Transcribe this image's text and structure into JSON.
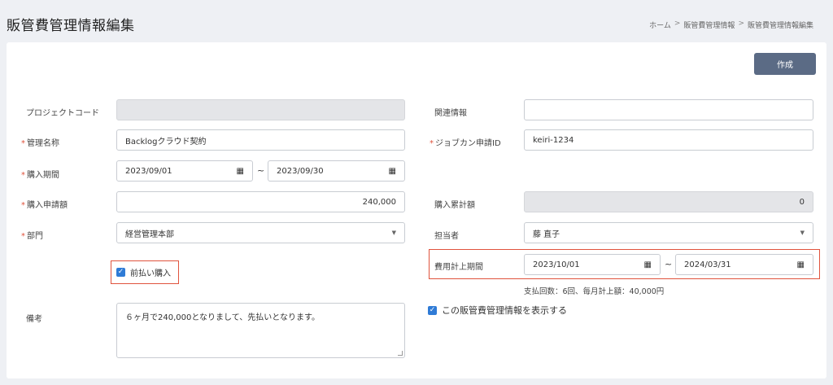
{
  "header": {
    "title": "販管費管理情報編集",
    "breadcrumb": [
      "ホーム",
      "販管費管理情報",
      "販管費管理情報編集"
    ],
    "breadcrumb_sep": ">"
  },
  "actions": {
    "create_label": "作成"
  },
  "form": {
    "project_code": {
      "label": "プロジェクトコード",
      "value": ""
    },
    "related_info": {
      "label": "関連情報",
      "value": ""
    },
    "management_name": {
      "label": "管理名称",
      "value": "Backlogクラウド契約"
    },
    "jobcan_id": {
      "label": "ジョブカン申請ID",
      "value": "keiri-1234"
    },
    "purchase_period": {
      "label": "購入期間",
      "start": "2023/09/01",
      "end": "2023/09/30"
    },
    "purchase_amount": {
      "label": "購入申請額",
      "value": "240,000"
    },
    "purchase_total": {
      "label": "購入累計額",
      "value": "0"
    },
    "department": {
      "label": "部門",
      "value": "経営管理本部"
    },
    "person": {
      "label": "担当者",
      "value": "藤 直子"
    },
    "prepaid": {
      "label": "前払い購入",
      "checked": true
    },
    "expense_period": {
      "label": "費用計上期間",
      "start": "2023/10/01",
      "end": "2024/03/31"
    },
    "payment_note": "支払回数：6回、毎月計上額：40,000円",
    "remarks": {
      "label": "備考",
      "value": "６ヶ月で240,000となりまして、先払いとなります。"
    },
    "show_toggle": {
      "label": "この販管費管理情報を表示する",
      "checked": true
    },
    "required_mark": "*",
    "tilde": "~"
  },
  "colors": {
    "accent": "#2f7bd6",
    "button": "#5b6b85",
    "highlight": "#e0533d"
  }
}
